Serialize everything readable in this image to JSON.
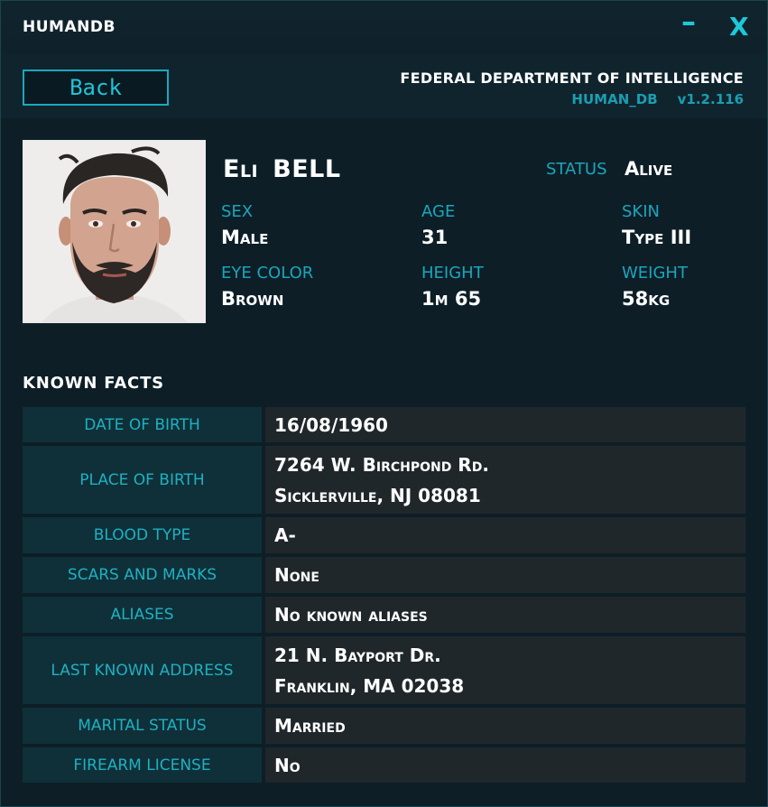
{
  "app": {
    "title": "HUMANDB",
    "minimize_label": "–",
    "close_label": "X"
  },
  "header": {
    "back_label": "Back",
    "department": "FEDERAL DEPARTMENT OF INTELLIGENCE",
    "db_name": "HUMAN_DB",
    "version": "v1.2.116"
  },
  "person": {
    "first_name": "Eli",
    "last_name": "BELL",
    "status_label": "STATUS",
    "status_value": "Alive",
    "attributes": [
      {
        "label": "SEX",
        "value": "Male"
      },
      {
        "label": "AGE",
        "value": "31"
      },
      {
        "label": "SKIN",
        "value": "Type III"
      },
      {
        "label": "EYE COLOR",
        "value": "Brown"
      },
      {
        "label": "HEIGHT",
        "value": "1m 65"
      },
      {
        "label": "WEIGHT",
        "value": "58kg"
      }
    ]
  },
  "known_facts": {
    "title": "KNOWN FACTS",
    "rows": [
      {
        "label": "DATE OF BIRTH",
        "lines": [
          "16/08/1960"
        ]
      },
      {
        "label": "PLACE OF BIRTH",
        "lines": [
          "7264 W. Birchpond Rd.",
          "Sicklerville, NJ 08081"
        ]
      },
      {
        "label": "BLOOD TYPE",
        "lines": [
          "A-"
        ]
      },
      {
        "label": "SCARS AND MARKS",
        "lines": [
          "None"
        ]
      },
      {
        "label": "ALIASES",
        "lines": [
          "No known aliases"
        ]
      },
      {
        "label": "LAST KNOWN ADDRESS",
        "lines": [
          "21 N. Bayport Dr.",
          "Franklin, MA 02038"
        ]
      },
      {
        "label": "MARITAL STATUS",
        "lines": [
          "Married"
        ]
      },
      {
        "label": "FIREARM LICENSE",
        "lines": [
          "No"
        ]
      }
    ]
  },
  "colors": {
    "accent": "#1aa6bc",
    "background": "#0d1e27",
    "label_cell": "#0f3038",
    "value_cell": "#20272b"
  }
}
